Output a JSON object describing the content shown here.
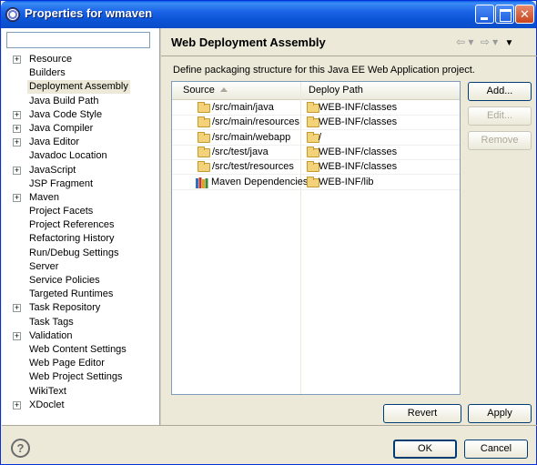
{
  "window": {
    "title": "Properties for wmaven",
    "title_icon": "settings-icon",
    "controls": [
      "minimize-icon",
      "maximize-icon",
      "close-icon"
    ]
  },
  "sidebar": {
    "filter_value": "",
    "selected": "Deployment Assembly",
    "items": [
      {
        "label": "Resource",
        "expandable": true
      },
      {
        "label": "Builders",
        "expandable": false
      },
      {
        "label": "Deployment Assembly",
        "expandable": false
      },
      {
        "label": "Java Build Path",
        "expandable": false
      },
      {
        "label": "Java Code Style",
        "expandable": true
      },
      {
        "label": "Java Compiler",
        "expandable": true
      },
      {
        "label": "Java Editor",
        "expandable": true
      },
      {
        "label": "Javadoc Location",
        "expandable": false
      },
      {
        "label": "JavaScript",
        "expandable": true
      },
      {
        "label": "JSP Fragment",
        "expandable": false
      },
      {
        "label": "Maven",
        "expandable": true
      },
      {
        "label": "Project Facets",
        "expandable": false
      },
      {
        "label": "Project References",
        "expandable": false
      },
      {
        "label": "Refactoring History",
        "expandable": false
      },
      {
        "label": "Run/Debug Settings",
        "expandable": false
      },
      {
        "label": "Server",
        "expandable": false
      },
      {
        "label": "Service Policies",
        "expandable": false
      },
      {
        "label": "Targeted Runtimes",
        "expandable": false
      },
      {
        "label": "Task Repository",
        "expandable": true
      },
      {
        "label": "Task Tags",
        "expandable": false
      },
      {
        "label": "Validation",
        "expandable": true
      },
      {
        "label": "Web Content Settings",
        "expandable": false
      },
      {
        "label": "Web Page Editor",
        "expandable": false
      },
      {
        "label": "Web Project Settings",
        "expandable": false
      },
      {
        "label": "WikiText",
        "expandable": false
      },
      {
        "label": "XDoclet",
        "expandable": true
      }
    ]
  },
  "page": {
    "title": "Web Deployment Assembly",
    "nav_icons": [
      "back-arrow-icon",
      "forward-arrow-icon",
      "view-menu-icon"
    ],
    "description": "Define packaging structure for this Java EE Web Application project.",
    "table": {
      "columns": [
        "Source",
        "Deploy Path"
      ],
      "rows": [
        {
          "source": "/src/main/java",
          "deploy": "WEB-INF/classes",
          "icon": "folder-icon"
        },
        {
          "source": "/src/main/resources",
          "deploy": "WEB-INF/classes",
          "icon": "folder-icon"
        },
        {
          "source": "/src/main/webapp",
          "deploy": "/",
          "icon": "folder-icon"
        },
        {
          "source": "/src/test/java",
          "deploy": "WEB-INF/classes",
          "icon": "folder-icon"
        },
        {
          "source": "/src/test/resources",
          "deploy": "WEB-INF/classes",
          "icon": "folder-icon"
        },
        {
          "source": "Maven Dependencies",
          "deploy": "WEB-INF/lib",
          "icon": "library-icon"
        }
      ]
    },
    "buttons": {
      "add": "Add...",
      "edit": "Edit...",
      "remove": "Remove",
      "revert": "Revert",
      "apply": "Apply"
    }
  },
  "footer": {
    "help_glyph": "?",
    "ok": "OK",
    "cancel": "Cancel"
  }
}
